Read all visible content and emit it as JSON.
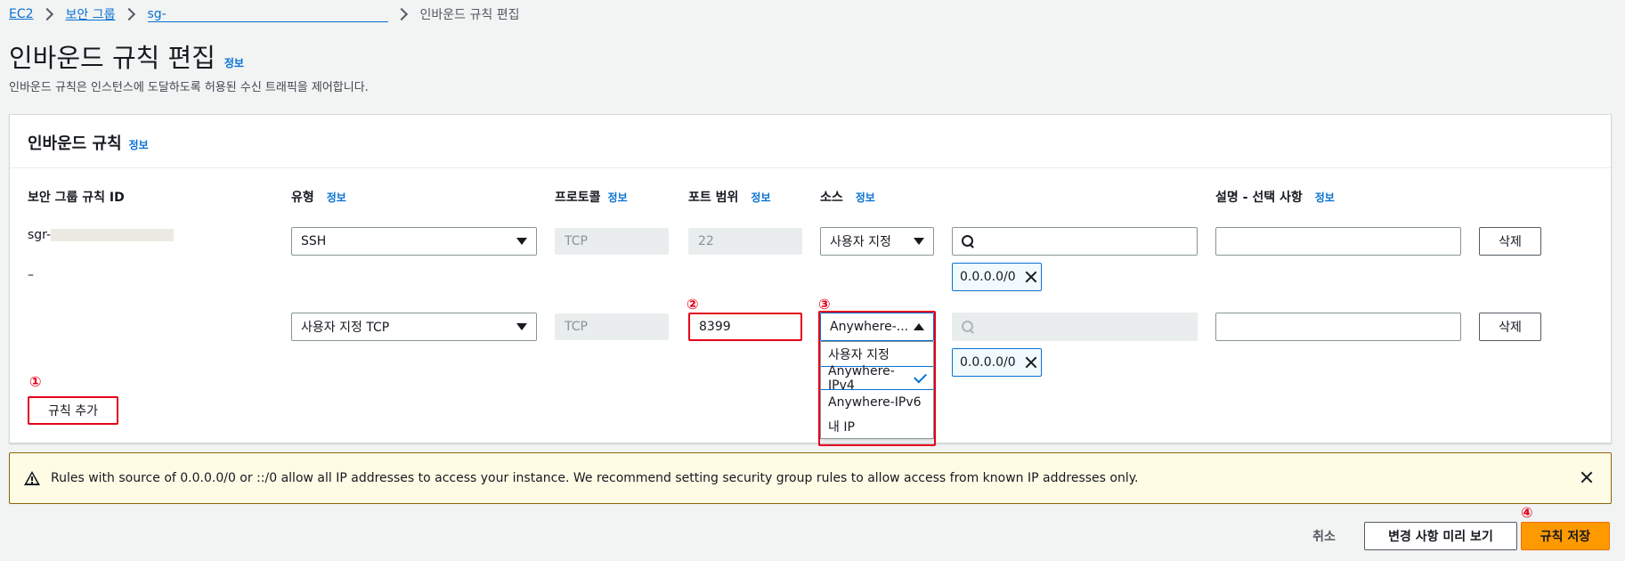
{
  "breadcrumb": {
    "ec2": "EC2",
    "security_groups": "보안 그룹",
    "sg_id": "sg-",
    "current": "인바운드 규칙 편집"
  },
  "page": {
    "title": "인바운드 규칙 편집",
    "info": "정보",
    "description": "인바운드 규칙은 인스턴스에 도달하도록 허용된 수신 트래픽을 제어합니다."
  },
  "panel": {
    "title": "인바운드 규칙",
    "info": "정보",
    "columns": {
      "rule_id": "보안 그룹 규칙 ID",
      "type": "유형",
      "protocol": "프로토콜",
      "port_range": "포트 범위",
      "source": "소스",
      "description": "설명 - 선택 사항",
      "info": "정보"
    },
    "rows": [
      {
        "rule_id": "sgr-",
        "type": "SSH",
        "protocol": "TCP",
        "port": "22",
        "source_mode": "사용자 지정",
        "search_value": "",
        "token": "0.0.0.0/0",
        "description": "",
        "delete": "삭제"
      },
      {
        "rule_id": "–",
        "type": "사용자 지정 TCP",
        "protocol": "TCP",
        "port": "8399",
        "source_mode": "Anywhere-...",
        "search_value": "",
        "token": "0.0.0.0/0",
        "description": "",
        "delete": "삭제"
      }
    ],
    "add_rule": "규칙 추가",
    "source_options": [
      "사용자 지정",
      "Anywhere-IPv4",
      "Anywhere-IPv6",
      "내 IP"
    ],
    "source_selected": "Anywhere-IPv4"
  },
  "annotations": {
    "one": "①",
    "two": "②",
    "three": "③",
    "four": "④"
  },
  "alert": {
    "text": "Rules with source of 0.0.0.0/0 or ::/0 allow all IP addresses to access your instance. We recommend setting security group rules to allow access from known IP addresses only."
  },
  "footer": {
    "cancel": "취소",
    "preview": "변경 사항 미리 보기",
    "save": "규칙 저장"
  },
  "colors": {
    "accent": "#0972d3",
    "primary": "#ff9900",
    "highlight": "#e4001b",
    "alert_bg": "#fffce6"
  }
}
